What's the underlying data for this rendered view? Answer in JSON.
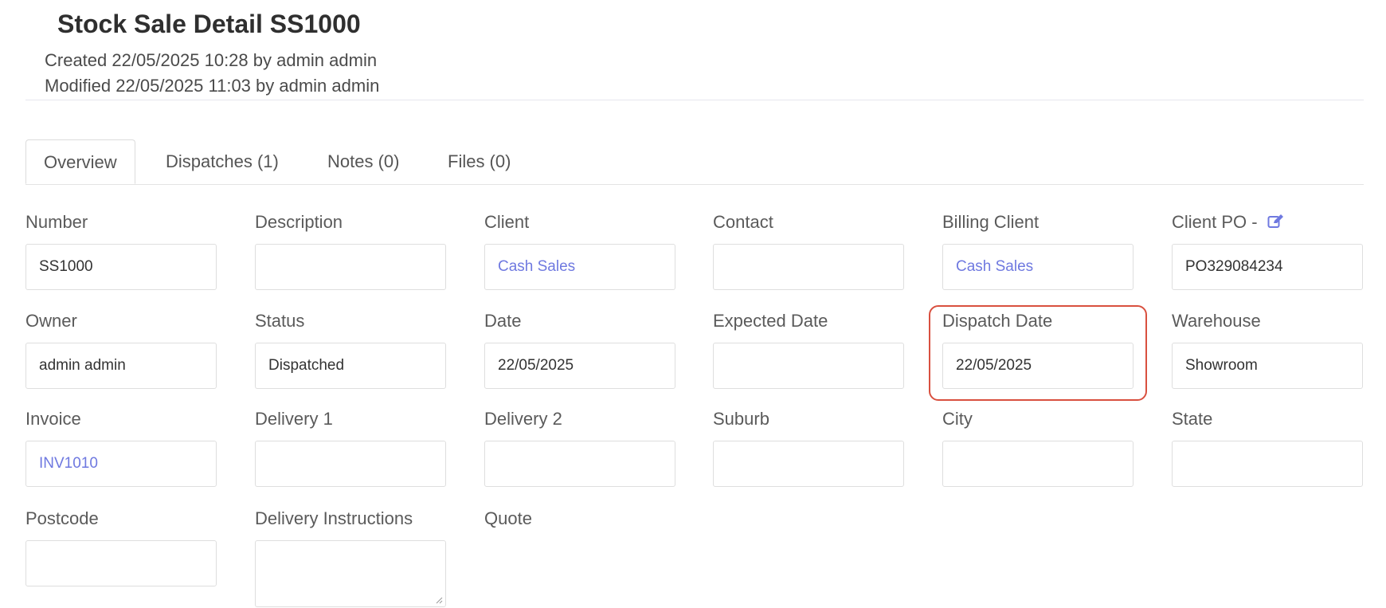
{
  "header": {
    "title": "Stock Sale Detail SS1000",
    "created": "Created 22/05/2025 10:28 by admin admin",
    "modified": "Modified 22/05/2025 11:03 by admin admin"
  },
  "tabs": [
    {
      "label": "Overview",
      "active": true
    },
    {
      "label": "Dispatches (1)",
      "active": false
    },
    {
      "label": "Notes (0)",
      "active": false
    },
    {
      "label": "Files (0)",
      "active": false
    }
  ],
  "fields": {
    "number": {
      "label": "Number",
      "value": "SS1000"
    },
    "description": {
      "label": "Description",
      "value": ""
    },
    "client": {
      "label": "Client",
      "value": "Cash Sales"
    },
    "contact": {
      "label": "Contact",
      "value": ""
    },
    "billing_client": {
      "label": "Billing Client",
      "value": "Cash Sales"
    },
    "client_po": {
      "label": "Client PO -",
      "value": "PO329084234"
    },
    "owner": {
      "label": "Owner",
      "value": "admin admin"
    },
    "status": {
      "label": "Status",
      "value": "Dispatched"
    },
    "date": {
      "label": "Date",
      "value": "22/05/2025"
    },
    "expected_date": {
      "label": "Expected Date",
      "value": ""
    },
    "dispatch_date": {
      "label": "Dispatch Date",
      "value": "22/05/2025"
    },
    "warehouse": {
      "label": "Warehouse",
      "value": "Showroom"
    },
    "invoice": {
      "label": "Invoice",
      "value": "INV1010"
    },
    "delivery1": {
      "label": "Delivery 1",
      "value": ""
    },
    "delivery2": {
      "label": "Delivery 2",
      "value": ""
    },
    "suburb": {
      "label": "Suburb",
      "value": ""
    },
    "city": {
      "label": "City",
      "value": ""
    },
    "state": {
      "label": "State",
      "value": ""
    },
    "postcode": {
      "label": "Postcode",
      "value": ""
    },
    "delivery_instructions": {
      "label": "Delivery Instructions",
      "value": ""
    },
    "quote": {
      "label": "Quote"
    }
  },
  "colors": {
    "link": "#6f79e0",
    "highlight": "#d9503f"
  },
  "icons": {
    "client_po_edit": "edit-icon"
  }
}
